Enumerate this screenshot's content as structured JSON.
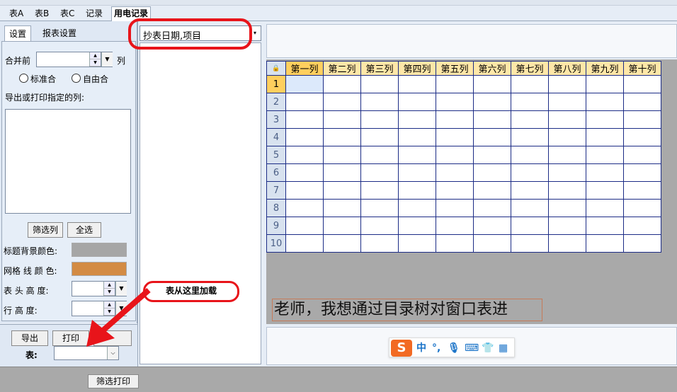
{
  "tabs": [
    "表A",
    "表B",
    "表C",
    "记录",
    "用电记录"
  ],
  "left": {
    "subtabs": [
      "设置",
      "报表设置"
    ],
    "merge_label": "合并前",
    "merge_unit": "列",
    "radio_standard": "标准合",
    "radio_free": "自由合",
    "export_cols_label": "导出或打印指定的列:",
    "filter_col_btn": "筛选列",
    "select_all_btn": "全选",
    "title_bg_label": "标题背景颜色:",
    "grid_color_label": "网格 线 颜 色:",
    "header_height_label": "表  头  高  度:",
    "row_height_label": "行    高    度:",
    "title_bg_color": "#a6a6a6",
    "grid_line_color": "#d38b44",
    "export_btn": "导出",
    "print_btn": "打印",
    "table_label": "表:"
  },
  "mid": {
    "combo_value": "抄表日期,项目",
    "callout": "表从这里加载"
  },
  "grid": {
    "headers": [
      "第一列",
      "第二列",
      "第三列",
      "第四列",
      "第五列",
      "第六列",
      "第七列",
      "第八列",
      "第九列",
      "第十列"
    ],
    "rows": [
      "1",
      "2",
      "3",
      "4",
      "5",
      "6",
      "7",
      "8",
      "9",
      "10"
    ]
  },
  "message": "老师，我想通过目录树对窗口表进",
  "ime": {
    "logo": "S",
    "lang": "中",
    "punct": "°,",
    "mic": "🎙",
    "keyboard": "⌨",
    "skin": "👕",
    "grid": "▦"
  },
  "bottom": {
    "filter_print_btn": "筛选打印"
  },
  "colors": {
    "highlight_red": "#e8141a",
    "header_yellow": "#ffe7a8",
    "grid_border": "#1c2c86"
  }
}
